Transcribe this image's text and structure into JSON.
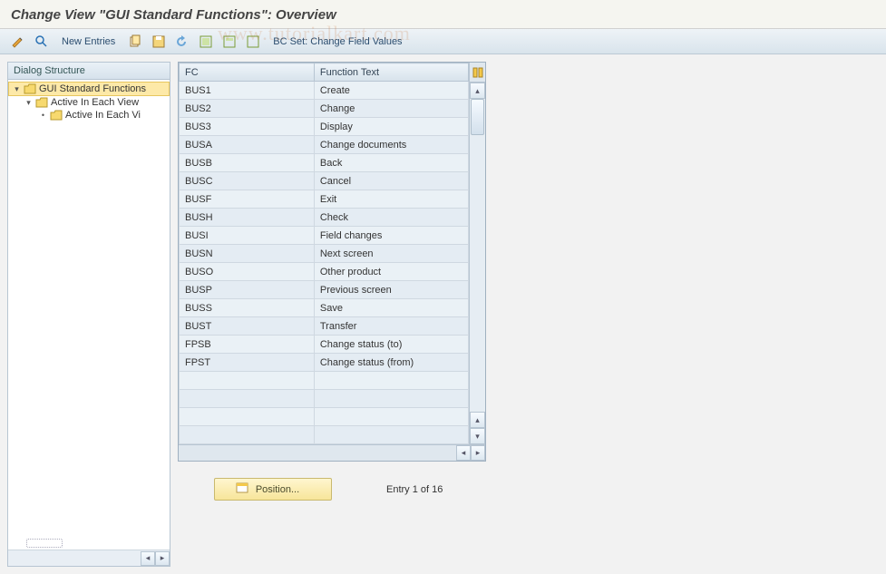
{
  "title": "Change View \"GUI Standard Functions\": Overview",
  "toolbar": {
    "new_entries": "New Entries",
    "bc_set_label": "BC Set: Change Field Values"
  },
  "sidebar": {
    "header": "Dialog Structure",
    "nodes": [
      {
        "label": "GUI Standard Functions",
        "selected": true
      },
      {
        "label": "Active In Each View"
      },
      {
        "label": "Active In Each Vi"
      }
    ]
  },
  "table": {
    "headers": {
      "fc": "FC",
      "ft": "Function Text"
    },
    "rows": [
      {
        "fc": "BUS1",
        "ft": "Create"
      },
      {
        "fc": "BUS2",
        "ft": "Change"
      },
      {
        "fc": "BUS3",
        "ft": "Display"
      },
      {
        "fc": "BUSA",
        "ft": "Change documents"
      },
      {
        "fc": "BUSB",
        "ft": "Back"
      },
      {
        "fc": "BUSC",
        "ft": "Cancel"
      },
      {
        "fc": "BUSF",
        "ft": "Exit"
      },
      {
        "fc": "BUSH",
        "ft": "Check"
      },
      {
        "fc": "BUSI",
        "ft": "Field changes"
      },
      {
        "fc": "BUSN",
        "ft": "Next screen"
      },
      {
        "fc": "BUSO",
        "ft": "Other product"
      },
      {
        "fc": "BUSP",
        "ft": "Previous screen"
      },
      {
        "fc": "BUSS",
        "ft": "Save"
      },
      {
        "fc": "BUST",
        "ft": "Transfer"
      },
      {
        "fc": "FPSB",
        "ft": "Change status (to)"
      },
      {
        "fc": "FPST",
        "ft": "Change status (from)"
      }
    ],
    "empty_rows": 4
  },
  "footer": {
    "position_label": "Position...",
    "entry_text": "Entry 1 of 16"
  }
}
